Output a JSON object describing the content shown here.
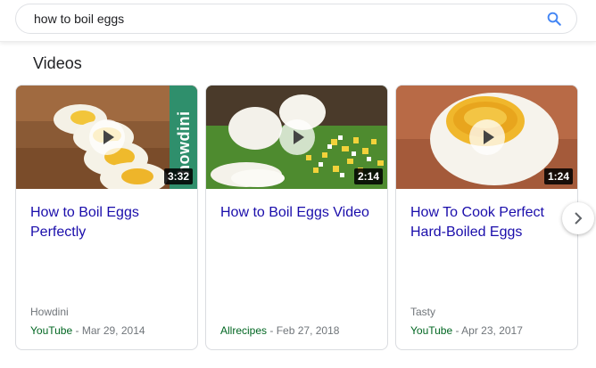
{
  "search": {
    "query": "how to boil eggs"
  },
  "section": {
    "title": "Videos"
  },
  "videos": [
    {
      "title": "How to Boil Eggs Perfectly",
      "duration": "3:32",
      "channel": "Howdini",
      "source": "YouTube",
      "date": "Mar 29, 2014",
      "overlay_text": "howdini"
    },
    {
      "title": "How to Boil Eggs Video",
      "duration": "2:14",
      "channel": "",
      "source": "Allrecipes",
      "date": "Feb 27, 2018"
    },
    {
      "title": "How To Cook Perfect Hard-Boiled Eggs",
      "duration": "1:24",
      "channel": "Tasty",
      "source": "YouTube",
      "date": "Apr 23, 2017"
    }
  ],
  "separator": " - ",
  "icons": {
    "search": "search-icon",
    "play": "play-icon",
    "next": "chevron-right-icon"
  },
  "colors": {
    "link": "#1a0dab",
    "source": "#006621",
    "search_icon": "#4285f4"
  }
}
